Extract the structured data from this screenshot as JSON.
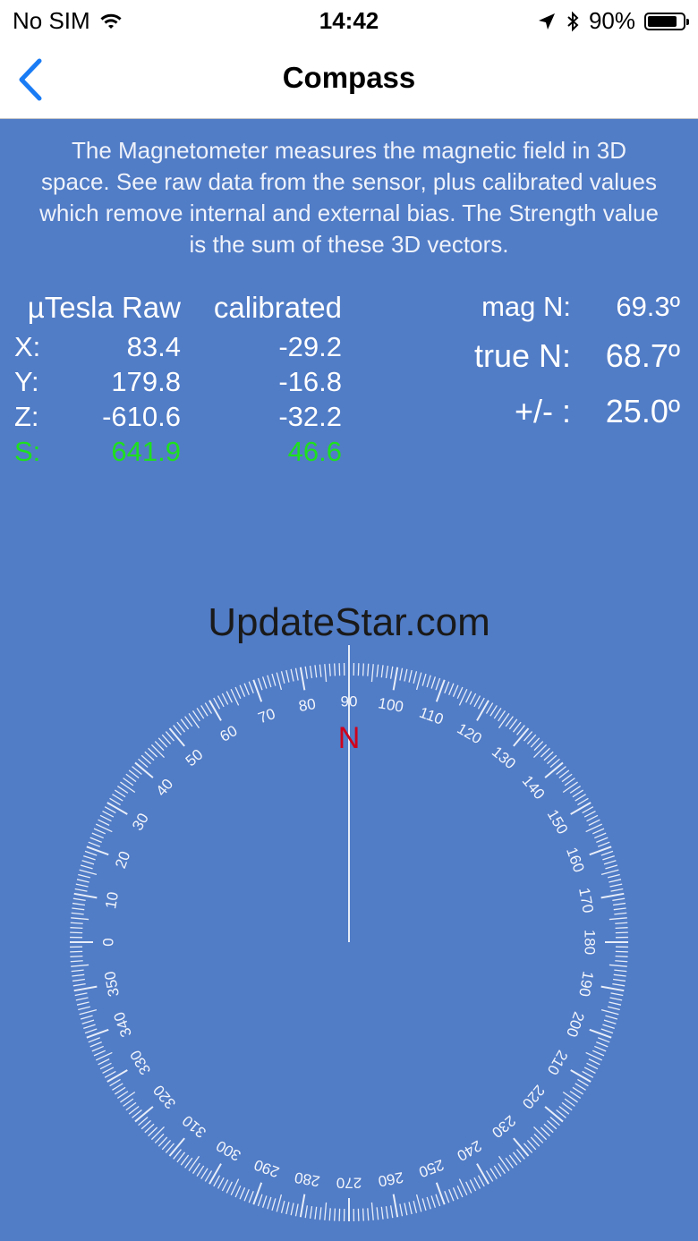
{
  "status_bar": {
    "carrier": "No SIM",
    "time": "14:42",
    "battery": "90%",
    "battery_level": 0.9
  },
  "nav": {
    "back_label": "",
    "title": "Compass"
  },
  "description": "The Magnetometer measures the magnetic field in 3D space.  See raw data from the sensor, plus calibrated values which remove internal and external bias.  The Strength value is the sum of these 3D vectors.",
  "sensor": {
    "raw_header": "µTesla Raw",
    "calibrated_header": "calibrated",
    "rows": [
      {
        "label": "X:",
        "raw": "83.4",
        "calibrated": "-29.2"
      },
      {
        "label": "Y:",
        "raw": "179.8",
        "calibrated": "-16.8"
      },
      {
        "label": "Z:",
        "raw": "-610.6",
        "calibrated": "-32.2"
      },
      {
        "label": "S:",
        "raw": "641.9",
        "calibrated": "46.6"
      }
    ],
    "strength_color": "#1ee01e"
  },
  "heading": {
    "mag_label": "mag N:",
    "mag_value": "69.3º",
    "true_label": "true N:",
    "true_value": "68.7º",
    "accuracy_label": "+/- :",
    "accuracy_value": "25.0º"
  },
  "watermark": "UpdateStar.com",
  "compass": {
    "north_label": "N",
    "north_color": "#d0021b",
    "labels": [
      "0",
      "10",
      "20",
      "30",
      "40",
      "50",
      "60",
      "70",
      "80",
      "90",
      "100",
      "110",
      "120",
      "130",
      "140",
      "150",
      "160",
      "170",
      "180",
      "190",
      "200",
      "210",
      "220",
      "230",
      "240",
      "250",
      "260",
      "270",
      "280",
      "290",
      "300",
      "310",
      "320",
      "330",
      "340",
      "350"
    ]
  }
}
